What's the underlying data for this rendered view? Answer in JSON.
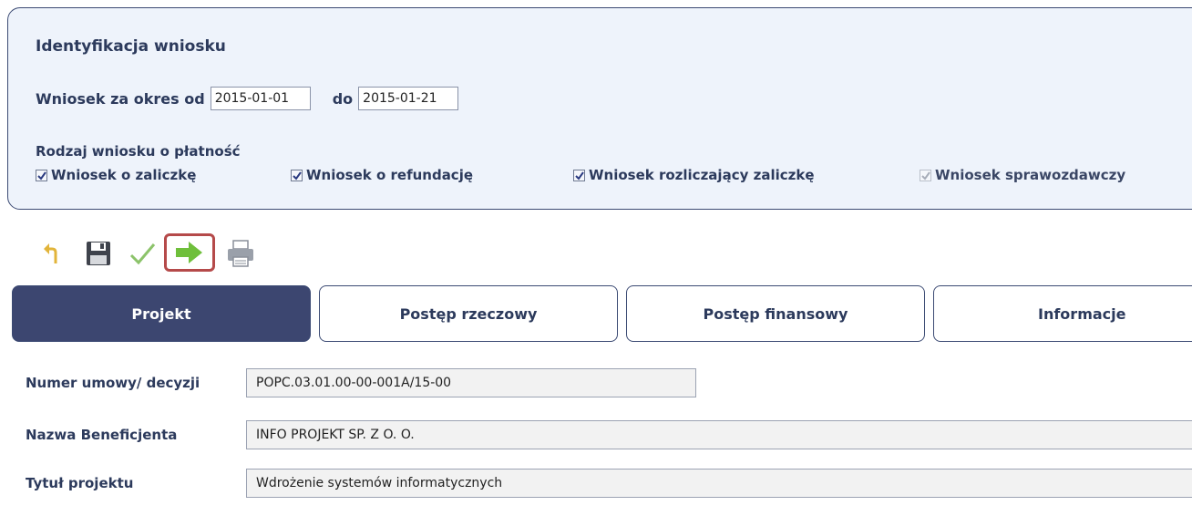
{
  "identification": {
    "title": "Identyfikacja wniosku",
    "period_from_label": "Wniosek za okres od",
    "period_from_value": "2015-01-01",
    "period_to_label": "do",
    "period_to_value": "2015-01-21",
    "payment_type_title": "Rodzaj wniosku o płatność",
    "checkboxes": [
      {
        "label": "Wniosek o zaliczkę",
        "checked": true,
        "enabled": true
      },
      {
        "label": "Wniosek o refundację",
        "checked": true,
        "enabled": true
      },
      {
        "label": "Wniosek rozliczający zaliczkę",
        "checked": true,
        "enabled": true
      },
      {
        "label": "Wniosek sprawozdawczy",
        "checked": true,
        "enabled": false
      }
    ]
  },
  "toolbar": {
    "icons": [
      "undo-icon",
      "save-icon",
      "validate-check-icon",
      "submit-arrow-icon",
      "print-icon"
    ],
    "highlighted": "submit-arrow-icon",
    "highlight_color": "#b54a4a"
  },
  "tabs": [
    {
      "label": "Projekt",
      "active": true
    },
    {
      "label": "Postęp rzeczowy",
      "active": false
    },
    {
      "label": "Postęp finansowy",
      "active": false
    },
    {
      "label": "Informacje",
      "active": false
    }
  ],
  "form": {
    "contract_label": "Numer umowy/ decyzji",
    "contract_value": "POPC.03.01.00-00-001A/15-00",
    "beneficiary_label": "Nazwa Beneficjenta",
    "beneficiary_value": "INFO PROJEKT SP. Z O. O.",
    "project_title_label": "Tytuł projektu",
    "project_title_value": "Wdrożenie systemów informatycznych"
  },
  "colors": {
    "panel_bg": "#eef3fb",
    "active_tab_bg": "#3c4670",
    "text": "#2c3a5c"
  }
}
